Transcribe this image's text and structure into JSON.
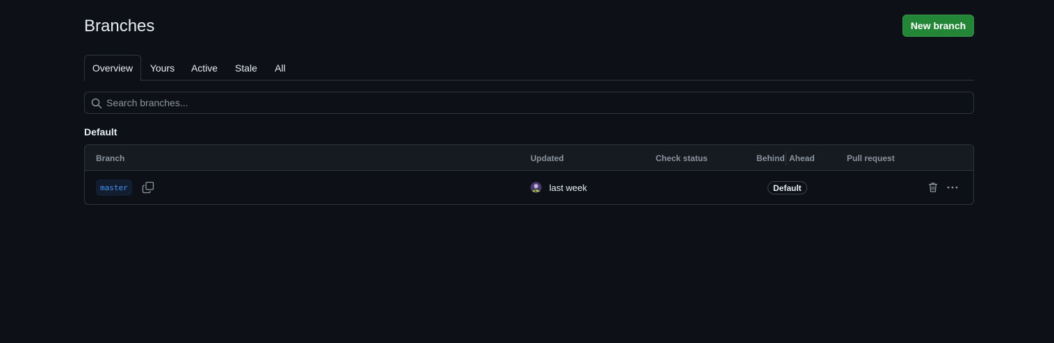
{
  "header": {
    "title": "Branches",
    "new_branch_label": "New branch"
  },
  "tabs": [
    {
      "label": "Overview",
      "selected": true
    },
    {
      "label": "Yours",
      "selected": false
    },
    {
      "label": "Active",
      "selected": false
    },
    {
      "label": "Stale",
      "selected": false
    },
    {
      "label": "All",
      "selected": false
    }
  ],
  "search": {
    "placeholder": "Search branches...",
    "value": ""
  },
  "section": {
    "heading": "Default"
  },
  "table": {
    "columns": {
      "branch": "Branch",
      "updated": "Updated",
      "check_status": "Check status",
      "behind": "Behind",
      "ahead": "Ahead",
      "pull_request": "Pull request"
    },
    "rows": [
      {
        "branch": "master",
        "updated": "last week",
        "badge": "Default"
      }
    ]
  },
  "icons": {
    "search": "search-icon",
    "copy": "copy-icon",
    "trash": "trash-icon",
    "more": "kebab-horizontal-icon",
    "avatar": "user-avatar"
  },
  "colors": {
    "background": "#0d1117",
    "primary_button": "#238636",
    "border": "#30363d",
    "link": "#4493f8",
    "muted": "#8b949e"
  }
}
